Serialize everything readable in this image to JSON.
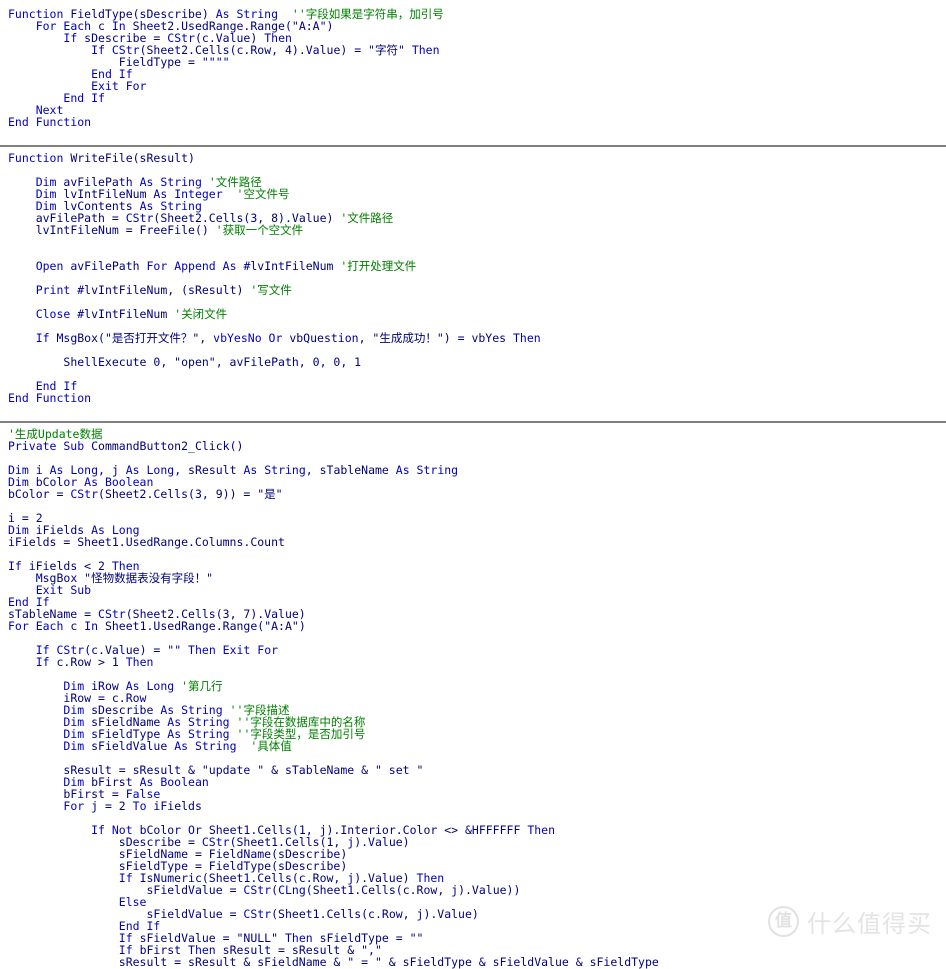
{
  "editor": {
    "title": "VBA Code Editor",
    "language": "VBA",
    "colors": {
      "keyword": "#0000C0",
      "identifier": "#000080",
      "comment": "#008000",
      "background": "#FFFFFF",
      "separator": "#808080",
      "watermark": "#E4E4E4"
    },
    "separator_after_lines": [
      11,
      32
    ]
  },
  "watermark": {
    "logo_char": "值",
    "text": "什么值得买"
  },
  "code": {
    "lines": [
      {
        "indent": 0,
        "tokens": [
          {
            "t": "kw",
            "s": "Function "
          },
          {
            "t": "idn",
            "s": "FieldType(sDescribe) "
          },
          {
            "t": "kw",
            "s": "As String"
          },
          {
            "t": "idn",
            "s": "  "
          },
          {
            "t": "cmt",
            "s": "''字段如果是字符串，加引号"
          }
        ]
      },
      {
        "indent": 1,
        "tokens": [
          {
            "t": "kw",
            "s": "For Each "
          },
          {
            "t": "idn",
            "s": "c "
          },
          {
            "t": "kw",
            "s": "In "
          },
          {
            "t": "idn",
            "s": "Sheet2.UsedRange.Range(\"A:A\")"
          }
        ]
      },
      {
        "indent": 2,
        "tokens": [
          {
            "t": "kw",
            "s": "If "
          },
          {
            "t": "idn",
            "s": "sDescribe = "
          },
          {
            "t": "kw",
            "s": "CStr"
          },
          {
            "t": "idn",
            "s": "(c.Value) "
          },
          {
            "t": "kw",
            "s": "Then"
          }
        ]
      },
      {
        "indent": 3,
        "tokens": [
          {
            "t": "kw",
            "s": "If "
          },
          {
            "t": "kw",
            "s": "CStr"
          },
          {
            "t": "idn",
            "s": "(Sheet2.Cells(c.Row, 4).Value) = \"字符\" "
          },
          {
            "t": "kw",
            "s": "Then"
          }
        ]
      },
      {
        "indent": 4,
        "tokens": [
          {
            "t": "idn",
            "s": "FieldType = \"\"\"\""
          }
        ]
      },
      {
        "indent": 3,
        "tokens": [
          {
            "t": "kw",
            "s": "End If"
          }
        ]
      },
      {
        "indent": 3,
        "tokens": [
          {
            "t": "kw",
            "s": "Exit For"
          }
        ]
      },
      {
        "indent": 2,
        "tokens": [
          {
            "t": "kw",
            "s": "End If"
          }
        ]
      },
      {
        "indent": 1,
        "tokens": [
          {
            "t": "kw",
            "s": "Next"
          }
        ]
      },
      {
        "indent": 0,
        "tokens": [
          {
            "t": "kw",
            "s": "End Function"
          }
        ]
      },
      {
        "indent": 0,
        "tokens": []
      },
      {
        "indent": 0,
        "sep": true,
        "tokens": []
      },
      {
        "indent": 0,
        "tokens": [
          {
            "t": "kw",
            "s": "Function "
          },
          {
            "t": "idn",
            "s": "WriteFile(sResult)"
          }
        ]
      },
      {
        "indent": 0,
        "tokens": []
      },
      {
        "indent": 1,
        "tokens": [
          {
            "t": "kw",
            "s": "Dim "
          },
          {
            "t": "idn",
            "s": "avFilePath "
          },
          {
            "t": "kw",
            "s": "As String "
          },
          {
            "t": "cmt",
            "s": "'文件路径"
          }
        ]
      },
      {
        "indent": 1,
        "tokens": [
          {
            "t": "kw",
            "s": "Dim "
          },
          {
            "t": "idn",
            "s": "lvIntFileNum "
          },
          {
            "t": "kw",
            "s": "As Integer"
          },
          {
            "t": "cmt",
            "s": "  '空文件号"
          }
        ]
      },
      {
        "indent": 1,
        "tokens": [
          {
            "t": "kw",
            "s": "Dim "
          },
          {
            "t": "idn",
            "s": "lvContents "
          },
          {
            "t": "kw",
            "s": "As String"
          }
        ]
      },
      {
        "indent": 1,
        "tokens": [
          {
            "t": "idn",
            "s": "avFilePath = "
          },
          {
            "t": "kw",
            "s": "CStr"
          },
          {
            "t": "idn",
            "s": "(Sheet2.Cells(3, 8).Value) "
          },
          {
            "t": "cmt",
            "s": "'文件路径"
          }
        ]
      },
      {
        "indent": 1,
        "tokens": [
          {
            "t": "idn",
            "s": "lvIntFileNum = FreeFile() "
          },
          {
            "t": "cmt",
            "s": "'获取一个空文件"
          }
        ]
      },
      {
        "indent": 0,
        "tokens": []
      },
      {
        "indent": 0,
        "tokens": []
      },
      {
        "indent": 1,
        "tokens": [
          {
            "t": "kw",
            "s": "Open "
          },
          {
            "t": "idn",
            "s": "avFilePath "
          },
          {
            "t": "kw",
            "s": "For Append As "
          },
          {
            "t": "idn",
            "s": "#lvIntFileNum "
          },
          {
            "t": "cmt",
            "s": "'打开处理文件"
          }
        ]
      },
      {
        "indent": 0,
        "tokens": []
      },
      {
        "indent": 1,
        "tokens": [
          {
            "t": "kw",
            "s": "Print "
          },
          {
            "t": "idn",
            "s": "#lvIntFileNum, (sResult) "
          },
          {
            "t": "cmt",
            "s": "'写文件"
          }
        ]
      },
      {
        "indent": 0,
        "tokens": []
      },
      {
        "indent": 1,
        "tokens": [
          {
            "t": "kw",
            "s": "Close "
          },
          {
            "t": "idn",
            "s": "#lvIntFileNum "
          },
          {
            "t": "cmt",
            "s": "'关闭文件"
          }
        ]
      },
      {
        "indent": 0,
        "tokens": []
      },
      {
        "indent": 1,
        "tokens": [
          {
            "t": "kw",
            "s": "If "
          },
          {
            "t": "idn",
            "s": "MsgBox(\"是否打开文件？\", "
          },
          {
            "t": "kw",
            "s": "vbYesNo Or "
          },
          {
            "t": "idn",
            "s": "vbQuestion, \"生成成功！\") = "
          },
          {
            "t": "idn",
            "s": "vbYes "
          },
          {
            "t": "kw",
            "s": "Then"
          }
        ]
      },
      {
        "indent": 0,
        "tokens": []
      },
      {
        "indent": 2,
        "tokens": [
          {
            "t": "idn",
            "s": "ShellExecute 0, \"open\", avFilePath, 0, 0, 1"
          }
        ]
      },
      {
        "indent": 0,
        "tokens": []
      },
      {
        "indent": 1,
        "tokens": [
          {
            "t": "kw",
            "s": "End If"
          }
        ]
      },
      {
        "indent": 0,
        "tokens": [
          {
            "t": "kw",
            "s": "End Function"
          }
        ]
      },
      {
        "indent": 0,
        "tokens": []
      },
      {
        "indent": 0,
        "sep": true,
        "tokens": []
      },
      {
        "indent": 0,
        "tokens": [
          {
            "t": "cmt",
            "s": "'生成Update数据"
          }
        ]
      },
      {
        "indent": 0,
        "tokens": [
          {
            "t": "kw",
            "s": "Private Sub "
          },
          {
            "t": "idn",
            "s": "CommandButton2_Click()"
          }
        ]
      },
      {
        "indent": 0,
        "tokens": []
      },
      {
        "indent": 0,
        "tokens": [
          {
            "t": "kw",
            "s": "Dim "
          },
          {
            "t": "idn",
            "s": "i "
          },
          {
            "t": "kw",
            "s": "As Long"
          },
          {
            "t": "idn",
            "s": ", j "
          },
          {
            "t": "kw",
            "s": "As Long"
          },
          {
            "t": "idn",
            "s": ", sResult "
          },
          {
            "t": "kw",
            "s": "As String"
          },
          {
            "t": "idn",
            "s": ", sTableName "
          },
          {
            "t": "kw",
            "s": "As String"
          }
        ]
      },
      {
        "indent": 0,
        "tokens": [
          {
            "t": "kw",
            "s": "Dim "
          },
          {
            "t": "idn",
            "s": "bColor "
          },
          {
            "t": "kw",
            "s": "As Boolean"
          }
        ]
      },
      {
        "indent": 0,
        "tokens": [
          {
            "t": "idn",
            "s": "bColor = "
          },
          {
            "t": "kw",
            "s": "CStr"
          },
          {
            "t": "idn",
            "s": "(Sheet2.Cells(3, 9)) = \"是\""
          }
        ]
      },
      {
        "indent": 0,
        "tokens": []
      },
      {
        "indent": 0,
        "tokens": [
          {
            "t": "idn",
            "s": "i = 2"
          }
        ]
      },
      {
        "indent": 0,
        "tokens": [
          {
            "t": "kw",
            "s": "Dim "
          },
          {
            "t": "idn",
            "s": "iFields "
          },
          {
            "t": "kw",
            "s": "As Long"
          }
        ]
      },
      {
        "indent": 0,
        "tokens": [
          {
            "t": "idn",
            "s": "iFields = Sheet1.UsedRange.Columns.Count"
          }
        ]
      },
      {
        "indent": 0,
        "tokens": []
      },
      {
        "indent": 0,
        "tokens": [
          {
            "t": "kw",
            "s": "If "
          },
          {
            "t": "idn",
            "s": "iFields < 2 "
          },
          {
            "t": "kw",
            "s": "Then"
          }
        ]
      },
      {
        "indent": 1,
        "tokens": [
          {
            "t": "idn",
            "s": "MsgBox \"怪物数据表没有字段！\""
          }
        ]
      },
      {
        "indent": 1,
        "tokens": [
          {
            "t": "kw",
            "s": "Exit Sub"
          }
        ]
      },
      {
        "indent": 0,
        "tokens": [
          {
            "t": "kw",
            "s": "End If"
          }
        ]
      },
      {
        "indent": 0,
        "tokens": [
          {
            "t": "idn",
            "s": "sTableName = "
          },
          {
            "t": "kw",
            "s": "CStr"
          },
          {
            "t": "idn",
            "s": "(Sheet2.Cells(3, 7).Value)"
          }
        ]
      },
      {
        "indent": 0,
        "tokens": [
          {
            "t": "kw",
            "s": "For Each "
          },
          {
            "t": "idn",
            "s": "c "
          },
          {
            "t": "kw",
            "s": "In "
          },
          {
            "t": "idn",
            "s": "Sheet1.UsedRange.Range(\"A:A\")"
          }
        ]
      },
      {
        "indent": 0,
        "tokens": []
      },
      {
        "indent": 1,
        "tokens": [
          {
            "t": "kw",
            "s": "If "
          },
          {
            "t": "kw",
            "s": "CStr"
          },
          {
            "t": "idn",
            "s": "(c.Value) = \"\" "
          },
          {
            "t": "kw",
            "s": "Then Exit For"
          }
        ]
      },
      {
        "indent": 1,
        "tokens": [
          {
            "t": "kw",
            "s": "If "
          },
          {
            "t": "idn",
            "s": "c.Row > 1 "
          },
          {
            "t": "kw",
            "s": "Then"
          }
        ]
      },
      {
        "indent": 0,
        "tokens": []
      },
      {
        "indent": 2,
        "tokens": [
          {
            "t": "kw",
            "s": "Dim "
          },
          {
            "t": "idn",
            "s": "iRow "
          },
          {
            "t": "kw",
            "s": "As Long "
          },
          {
            "t": "cmt",
            "s": "'第几行"
          }
        ]
      },
      {
        "indent": 2,
        "tokens": [
          {
            "t": "idn",
            "s": "iRow = c.Row"
          }
        ]
      },
      {
        "indent": 2,
        "tokens": [
          {
            "t": "kw",
            "s": "Dim "
          },
          {
            "t": "idn",
            "s": "sDescribe "
          },
          {
            "t": "kw",
            "s": "As String "
          },
          {
            "t": "cmt",
            "s": "''字段描述"
          }
        ]
      },
      {
        "indent": 2,
        "tokens": [
          {
            "t": "kw",
            "s": "Dim "
          },
          {
            "t": "idn",
            "s": "sFieldName "
          },
          {
            "t": "kw",
            "s": "As String "
          },
          {
            "t": "cmt",
            "s": "''字段在数据库中的名称"
          }
        ]
      },
      {
        "indent": 2,
        "tokens": [
          {
            "t": "kw",
            "s": "Dim "
          },
          {
            "t": "idn",
            "s": "sFieldType "
          },
          {
            "t": "kw",
            "s": "As String "
          },
          {
            "t": "cmt",
            "s": "''字段类型，是否加引号"
          }
        ]
      },
      {
        "indent": 2,
        "tokens": [
          {
            "t": "kw",
            "s": "Dim "
          },
          {
            "t": "idn",
            "s": "sFieldValue "
          },
          {
            "t": "kw",
            "s": "As String"
          },
          {
            "t": "cmt",
            "s": "  '具体值"
          }
        ]
      },
      {
        "indent": 0,
        "tokens": []
      },
      {
        "indent": 2,
        "tokens": [
          {
            "t": "idn",
            "s": "sResult = sResult & \"update \" & sTableName & \" set \""
          }
        ]
      },
      {
        "indent": 2,
        "tokens": [
          {
            "t": "kw",
            "s": "Dim "
          },
          {
            "t": "idn",
            "s": "bFirst "
          },
          {
            "t": "kw",
            "s": "As Boolean"
          }
        ]
      },
      {
        "indent": 2,
        "tokens": [
          {
            "t": "idn",
            "s": "bFirst = "
          },
          {
            "t": "kw",
            "s": "False"
          }
        ]
      },
      {
        "indent": 2,
        "tokens": [
          {
            "t": "kw",
            "s": "For "
          },
          {
            "t": "idn",
            "s": "j = 2 "
          },
          {
            "t": "kw",
            "s": "To "
          },
          {
            "t": "idn",
            "s": "iFields"
          }
        ]
      },
      {
        "indent": 0,
        "tokens": []
      },
      {
        "indent": 3,
        "tokens": [
          {
            "t": "kw",
            "s": "If Not "
          },
          {
            "t": "idn",
            "s": "bColor "
          },
          {
            "t": "kw",
            "s": "Or "
          },
          {
            "t": "idn",
            "s": "Sheet1.Cells(1, j).Interior.Color <> &HFFFFFF "
          },
          {
            "t": "kw",
            "s": "Then"
          }
        ]
      },
      {
        "indent": 4,
        "tokens": [
          {
            "t": "idn",
            "s": "sDescribe = "
          },
          {
            "t": "kw",
            "s": "CStr"
          },
          {
            "t": "idn",
            "s": "(Sheet1.Cells(1, j).Value)"
          }
        ]
      },
      {
        "indent": 4,
        "tokens": [
          {
            "t": "idn",
            "s": "sFieldName = FieldName(sDescribe)"
          }
        ]
      },
      {
        "indent": 4,
        "tokens": [
          {
            "t": "idn",
            "s": "sFieldType = FieldType(sDescribe)"
          }
        ]
      },
      {
        "indent": 4,
        "tokens": [
          {
            "t": "kw",
            "s": "If "
          },
          {
            "t": "idn",
            "s": "IsNumeric(Sheet1.Cells(c.Row, j).Value) "
          },
          {
            "t": "kw",
            "s": "Then"
          }
        ]
      },
      {
        "indent": 5,
        "tokens": [
          {
            "t": "idn",
            "s": "sFieldValue = "
          },
          {
            "t": "kw",
            "s": "CStr"
          },
          {
            "t": "idn",
            "s": "("
          },
          {
            "t": "kw",
            "s": "CLng"
          },
          {
            "t": "idn",
            "s": "(Sheet1.Cells(c.Row, j).Value))"
          }
        ]
      },
      {
        "indent": 4,
        "tokens": [
          {
            "t": "kw",
            "s": "Else"
          }
        ]
      },
      {
        "indent": 5,
        "tokens": [
          {
            "t": "idn",
            "s": "sFieldValue = "
          },
          {
            "t": "kw",
            "s": "CStr"
          },
          {
            "t": "idn",
            "s": "(Sheet1.Cells(c.Row, j).Value)"
          }
        ]
      },
      {
        "indent": 4,
        "tokens": [
          {
            "t": "kw",
            "s": "End If"
          }
        ]
      },
      {
        "indent": 4,
        "tokens": [
          {
            "t": "kw",
            "s": "If "
          },
          {
            "t": "idn",
            "s": "sFieldValue = \"NULL\" "
          },
          {
            "t": "kw",
            "s": "Then "
          },
          {
            "t": "idn",
            "s": "sFieldType = \"\""
          }
        ]
      },
      {
        "indent": 4,
        "tokens": [
          {
            "t": "kw",
            "s": "If "
          },
          {
            "t": "idn",
            "s": "bFirst "
          },
          {
            "t": "kw",
            "s": "Then "
          },
          {
            "t": "idn",
            "s": "sResult = sResult & \",\""
          }
        ]
      },
      {
        "indent": 4,
        "tokens": [
          {
            "t": "idn",
            "s": "sResult = sResult & sFieldName & \" = \" & sFieldType & sFieldValue & sFieldType"
          }
        ]
      }
    ]
  }
}
